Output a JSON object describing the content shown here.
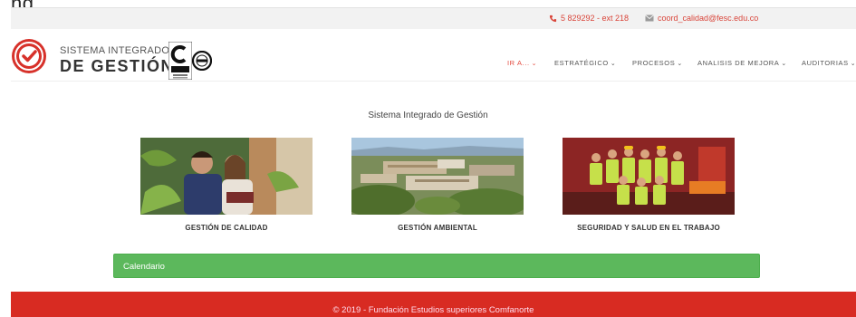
{
  "cutoff_text": "ng",
  "topbar": {
    "phone": "5 829292 - ext 218",
    "email": "coord_calidad@fesc.edu.co",
    "accent_color": "#d9453a"
  },
  "brand": {
    "line1": "SISTEMA INTEGRADO",
    "line2": "DE GESTIÓN",
    "logo_color": "#d7312a"
  },
  "nav": {
    "items": [
      {
        "label": "IR A...",
        "active": true
      },
      {
        "label": "ESTRATÉGICO"
      },
      {
        "label": "PROCESOS"
      },
      {
        "label": "ANALISIS DE MEJORA"
      },
      {
        "label": "AUDITORIAS"
      }
    ],
    "chevron": "⌄"
  },
  "main": {
    "title": "Sistema Integrado de Gestión",
    "cards": [
      {
        "label": "GESTIÓN DE CALIDAD",
        "image": "students-photo"
      },
      {
        "label": "GESTIÓN AMBIENTAL",
        "image": "campus-aerial-photo"
      },
      {
        "label": "SEGURIDAD Y SALUD EN EL TRABAJO",
        "image": "safety-brigade-photo"
      }
    ]
  },
  "calendar": {
    "label": "Calendario",
    "color": "#5cb85c"
  },
  "footer": {
    "text": "© 2019 - Fundación Estudios superiores Comfanorte",
    "color": "#d82b22"
  }
}
